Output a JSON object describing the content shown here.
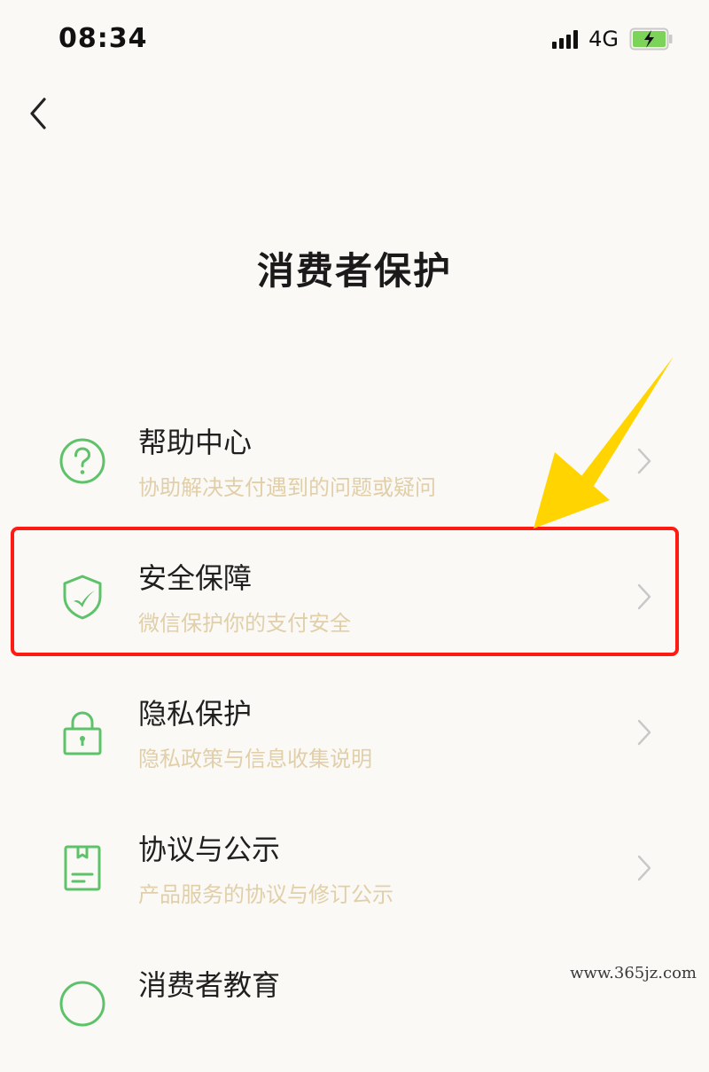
{
  "status_bar": {
    "time": "08:34",
    "network": "4G"
  },
  "icons": {
    "back": "chevron-left-icon",
    "signal": "cellular-signal-icon",
    "battery": "battery-charging-icon",
    "chevron": "chevron-right-icon"
  },
  "page": {
    "title": "消费者保护"
  },
  "menu": [
    {
      "title": "帮助中心",
      "desc": "协助解决支付遇到的问题或疑问",
      "icon": "help-circle-icon"
    },
    {
      "title": "安全保障",
      "desc": "微信保护你的支付安全",
      "icon": "shield-check-icon"
    },
    {
      "title": "隐私保护",
      "desc": "隐私政策与信息收集说明",
      "icon": "lock-icon"
    },
    {
      "title": "协议与公示",
      "desc": "产品服务的协议与修订公示",
      "icon": "document-icon"
    },
    {
      "title": "消费者教育",
      "desc": "",
      "icon": "education-icon"
    }
  ],
  "colors": {
    "accent_green": "#5ec26a",
    "description_tan": "#e0cfa8",
    "highlight_red": "#ff1a12",
    "arrow_yellow": "#ffd400",
    "battery_green": "#7cd35a"
  },
  "watermark": "www.365jz.com"
}
